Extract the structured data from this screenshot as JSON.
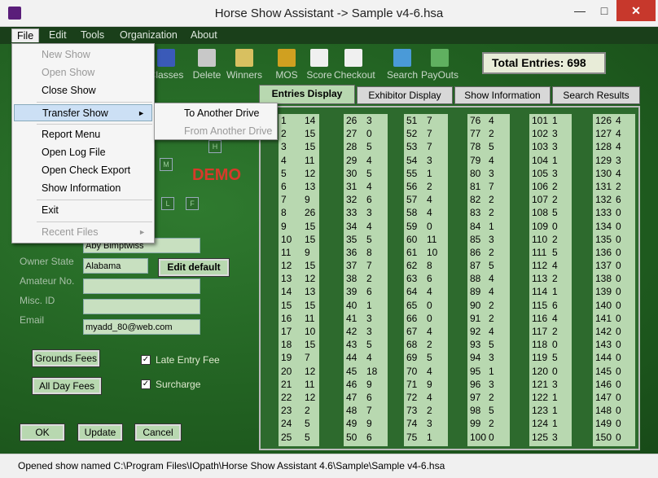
{
  "window": {
    "title": "Horse Show Assistant  ->  Sample v4-6.hsa",
    "min": "—",
    "max": "□",
    "close": "✕"
  },
  "menubar": [
    "File",
    "Edit",
    "Tools",
    "Organization",
    "About"
  ],
  "toolbar": [
    {
      "label": "Classes",
      "icon": "grid-icon",
      "color": "#3a5ab8"
    },
    {
      "label": "Delete",
      "icon": "delete-x-icon",
      "color": "#c8c8c8"
    },
    {
      "label": "Winners",
      "icon": "winners-icon",
      "color": "#d8c060"
    },
    {
      "label": "MOS",
      "icon": "people-icon",
      "color": "#d0a020"
    },
    {
      "label": "Score",
      "icon": "checkbox-icon",
      "color": "#f0f0f0"
    },
    {
      "label": "Checkout",
      "icon": "cart-icon",
      "color": "#f0f0f0"
    },
    {
      "label": "Search",
      "icon": "magnifier-icon",
      "color": "#4a9ad8"
    },
    {
      "label": "PayOuts",
      "icon": "dollar-icon",
      "color": "#60b060"
    }
  ],
  "total_entries": "Total Entries:  698",
  "demo": "DEMO",
  "form": {
    "owner_name": "Aby Bimptwiss",
    "owner_state_label": "Owner State",
    "owner_state": "Alabama",
    "edit_default": "Edit default",
    "amateur_label": "Amateur No.",
    "misc_label": "Misc. ID",
    "email_label": "Email",
    "email": "myadd_80@web.com",
    "grounds_fees": "Grounds Fees",
    "all_day_fees": "All Day Fees",
    "late_entry": "Late Entry Fee",
    "surcharge": "Surcharge",
    "ok": "OK",
    "update": "Update",
    "cancel": "Cancel",
    "btn_h": "H",
    "btn_m": "M",
    "btn_l": "L",
    "btn_f": "F"
  },
  "tabs": [
    "Entries Display",
    "Exhibitor Display",
    "Show Information",
    "Search Results"
  ],
  "entries": [
    [
      [
        "1",
        "14"
      ],
      [
        "2",
        "15"
      ],
      [
        "3",
        "15"
      ],
      [
        "4",
        "11"
      ],
      [
        "5",
        "12"
      ],
      [
        "6",
        "13"
      ],
      [
        "7",
        "9"
      ],
      [
        "8",
        "26"
      ],
      [
        "9",
        "15"
      ],
      [
        "10",
        "15"
      ],
      [
        "11",
        "9"
      ],
      [
        "12",
        "15"
      ],
      [
        "13",
        "12"
      ],
      [
        "14",
        "13"
      ],
      [
        "15",
        "15"
      ],
      [
        "16",
        "11"
      ],
      [
        "17",
        "10"
      ],
      [
        "18",
        "15"
      ],
      [
        "19",
        "7"
      ],
      [
        "20",
        "12"
      ],
      [
        "21",
        "11"
      ],
      [
        "22",
        "12"
      ],
      [
        "23",
        "2"
      ],
      [
        "24",
        "5"
      ],
      [
        "25",
        "5"
      ]
    ],
    [
      [
        "26",
        "3"
      ],
      [
        "27",
        "0"
      ],
      [
        "28",
        "5"
      ],
      [
        "29",
        "4"
      ],
      [
        "30",
        "5"
      ],
      [
        "31",
        "4"
      ],
      [
        "32",
        "6"
      ],
      [
        "33",
        "3"
      ],
      [
        "34",
        "4"
      ],
      [
        "35",
        "5"
      ],
      [
        "36",
        "8"
      ],
      [
        "37",
        "7"
      ],
      [
        "38",
        "2"
      ],
      [
        "39",
        "6"
      ],
      [
        "40",
        "1"
      ],
      [
        "41",
        "3"
      ],
      [
        "42",
        "3"
      ],
      [
        "43",
        "5"
      ],
      [
        "44",
        "4"
      ],
      [
        "45",
        "18"
      ],
      [
        "46",
        "9"
      ],
      [
        "47",
        "6"
      ],
      [
        "48",
        "7"
      ],
      [
        "49",
        "9"
      ],
      [
        "50",
        "6"
      ]
    ],
    [
      [
        "51",
        "7"
      ],
      [
        "52",
        "7"
      ],
      [
        "53",
        "7"
      ],
      [
        "54",
        "3"
      ],
      [
        "55",
        "1"
      ],
      [
        "56",
        "2"
      ],
      [
        "57",
        "4"
      ],
      [
        "58",
        "4"
      ],
      [
        "59",
        "0"
      ],
      [
        "60",
        "11"
      ],
      [
        "61",
        "10"
      ],
      [
        "62",
        "8"
      ],
      [
        "63",
        "6"
      ],
      [
        "64",
        "4"
      ],
      [
        "65",
        "0"
      ],
      [
        "66",
        "0"
      ],
      [
        "67",
        "4"
      ],
      [
        "68",
        "2"
      ],
      [
        "69",
        "5"
      ],
      [
        "70",
        "4"
      ],
      [
        "71",
        "9"
      ],
      [
        "72",
        "4"
      ],
      [
        "73",
        "2"
      ],
      [
        "74",
        "3"
      ],
      [
        "75",
        "1"
      ]
    ],
    [
      [
        "76",
        "4"
      ],
      [
        "77",
        "2"
      ],
      [
        "78",
        "5"
      ],
      [
        "79",
        "4"
      ],
      [
        "80",
        "3"
      ],
      [
        "81",
        "7"
      ],
      [
        "82",
        "2"
      ],
      [
        "83",
        "2"
      ],
      [
        "84",
        "1"
      ],
      [
        "85",
        "3"
      ],
      [
        "86",
        "2"
      ],
      [
        "87",
        "5"
      ],
      [
        "88",
        "4"
      ],
      [
        "89",
        "4"
      ],
      [
        "90",
        "2"
      ],
      [
        "91",
        "2"
      ],
      [
        "92",
        "4"
      ],
      [
        "93",
        "5"
      ],
      [
        "94",
        "3"
      ],
      [
        "95",
        "1"
      ],
      [
        "96",
        "3"
      ],
      [
        "97",
        "2"
      ],
      [
        "98",
        "5"
      ],
      [
        "99",
        "2"
      ],
      [
        "100",
        "0"
      ]
    ],
    [
      [
        "101",
        "1"
      ],
      [
        "102",
        "3"
      ],
      [
        "103",
        "3"
      ],
      [
        "104",
        "1"
      ],
      [
        "105",
        "3"
      ],
      [
        "106",
        "2"
      ],
      [
        "107",
        "2"
      ],
      [
        "108",
        "5"
      ],
      [
        "109",
        "0"
      ],
      [
        "110",
        "2"
      ],
      [
        "111",
        "5"
      ],
      [
        "112",
        "4"
      ],
      [
        "113",
        "2"
      ],
      [
        "114",
        "1"
      ],
      [
        "115",
        "6"
      ],
      [
        "116",
        "4"
      ],
      [
        "117",
        "2"
      ],
      [
        "118",
        "0"
      ],
      [
        "119",
        "5"
      ],
      [
        "120",
        "0"
      ],
      [
        "121",
        "3"
      ],
      [
        "122",
        "1"
      ],
      [
        "123",
        "1"
      ],
      [
        "124",
        "1"
      ],
      [
        "125",
        "3"
      ]
    ],
    [
      [
        "126",
        "4"
      ],
      [
        "127",
        "4"
      ],
      [
        "128",
        "4"
      ],
      [
        "129",
        "3"
      ],
      [
        "130",
        "4"
      ],
      [
        "131",
        "2"
      ],
      [
        "132",
        "6"
      ],
      [
        "133",
        "0"
      ],
      [
        "134",
        "0"
      ],
      [
        "135",
        "0"
      ],
      [
        "136",
        "0"
      ],
      [
        "137",
        "0"
      ],
      [
        "138",
        "0"
      ],
      [
        "139",
        "0"
      ],
      [
        "140",
        "0"
      ],
      [
        "141",
        "0"
      ],
      [
        "142",
        "0"
      ],
      [
        "143",
        "0"
      ],
      [
        "144",
        "0"
      ],
      [
        "145",
        "0"
      ],
      [
        "146",
        "0"
      ],
      [
        "147",
        "0"
      ],
      [
        "148",
        "0"
      ],
      [
        "149",
        "0"
      ],
      [
        "150",
        "0"
      ]
    ]
  ],
  "file_menu": [
    {
      "label": "New Show",
      "disabled": true
    },
    {
      "label": "Open Show",
      "disabled": true
    },
    {
      "label": "Close Show",
      "disabled": false
    },
    {
      "sep": true
    },
    {
      "label": "Transfer Show",
      "disabled": false,
      "selected": true,
      "arrow": "►"
    },
    {
      "sep": true
    },
    {
      "label": "Report Menu",
      "disabled": false
    },
    {
      "label": "Open Log File",
      "disabled": false
    },
    {
      "label": "Open Check Export",
      "disabled": false
    },
    {
      "label": "Show Information",
      "disabled": false
    },
    {
      "sep": true
    },
    {
      "label": "Exit",
      "disabled": false
    },
    {
      "sep": true
    },
    {
      "label": "Recent Files",
      "disabled": true,
      "arrow": "►"
    }
  ],
  "submenu": [
    {
      "label": "To Another Drive",
      "disabled": false
    },
    {
      "label": "From Another Drive",
      "disabled": true
    }
  ],
  "status": "Opened show named C:\\Program Files\\IOpath\\Horse Show Assistant 4.6\\Sample\\Sample v4-6.hsa"
}
